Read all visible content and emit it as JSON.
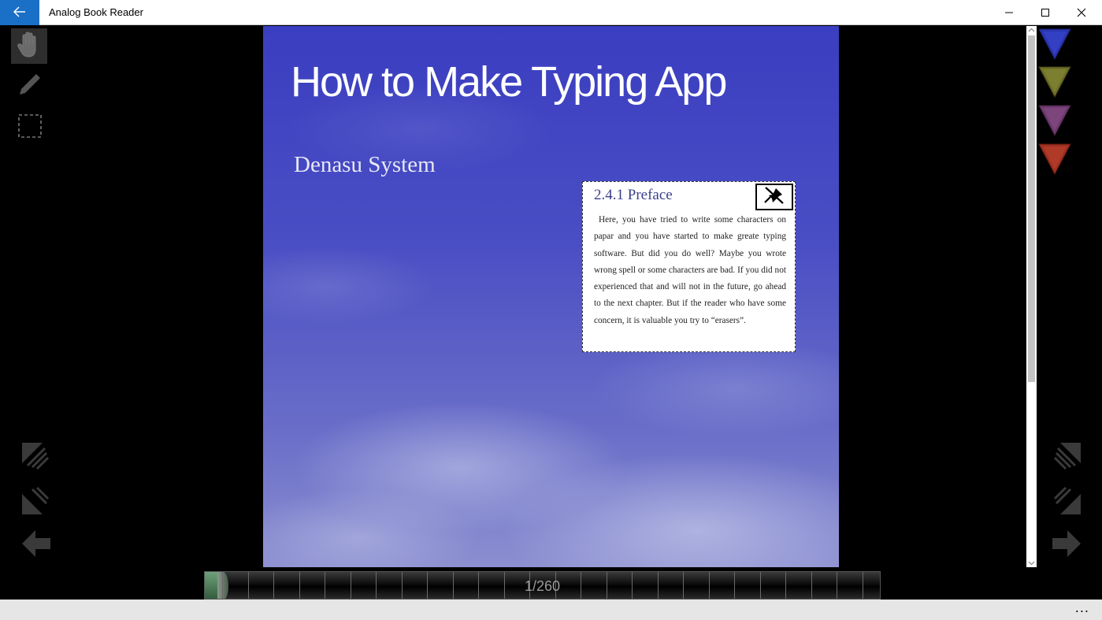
{
  "window": {
    "title": "Analog Book Reader",
    "back_icon": "arrow-left-icon",
    "controls": [
      "minimize-icon",
      "maximize-icon",
      "close-icon"
    ],
    "accent": "#1a6fc7"
  },
  "left_toolbar": {
    "tools": [
      "hand-tool-icon",
      "pencil-tool-icon",
      "select-tool-icon"
    ],
    "nav": [
      "first-page-icon",
      "previous-chapter-icon",
      "previous-page-icon"
    ]
  },
  "book": {
    "title": "How to Make Typing App",
    "author": "Denasu System"
  },
  "note": {
    "heading": "2.4.1 Preface",
    "pin_icon": "unpin-icon",
    "body": "Here, you have tried to write some characters on papar and you have started to make greate typing software. But did you do well? Maybe you wrote wrong spell or some characters are bad. If you did not experienced that and will not in the future, go ahead to the next chapter. But if the reader who have some concern, it is valuable you try to “erasers”."
  },
  "bookmarks": [
    {
      "name": "bookmark-blue-icon",
      "color": "#2a35b0"
    },
    {
      "name": "bookmark-olive-icon",
      "color": "#6e7028"
    },
    {
      "name": "bookmark-purple-icon",
      "color": "#6e3a6e"
    },
    {
      "name": "bookmark-red-icon",
      "color": "#a03020"
    }
  ],
  "right_toolbar": {
    "nav": [
      "last-page-icon",
      "next-chapter-icon",
      "next-page-icon"
    ]
  },
  "timeline": {
    "page_label": "1/260",
    "current_page": 1,
    "total_pages": 260
  },
  "bottom_bar": {
    "more": "..."
  }
}
